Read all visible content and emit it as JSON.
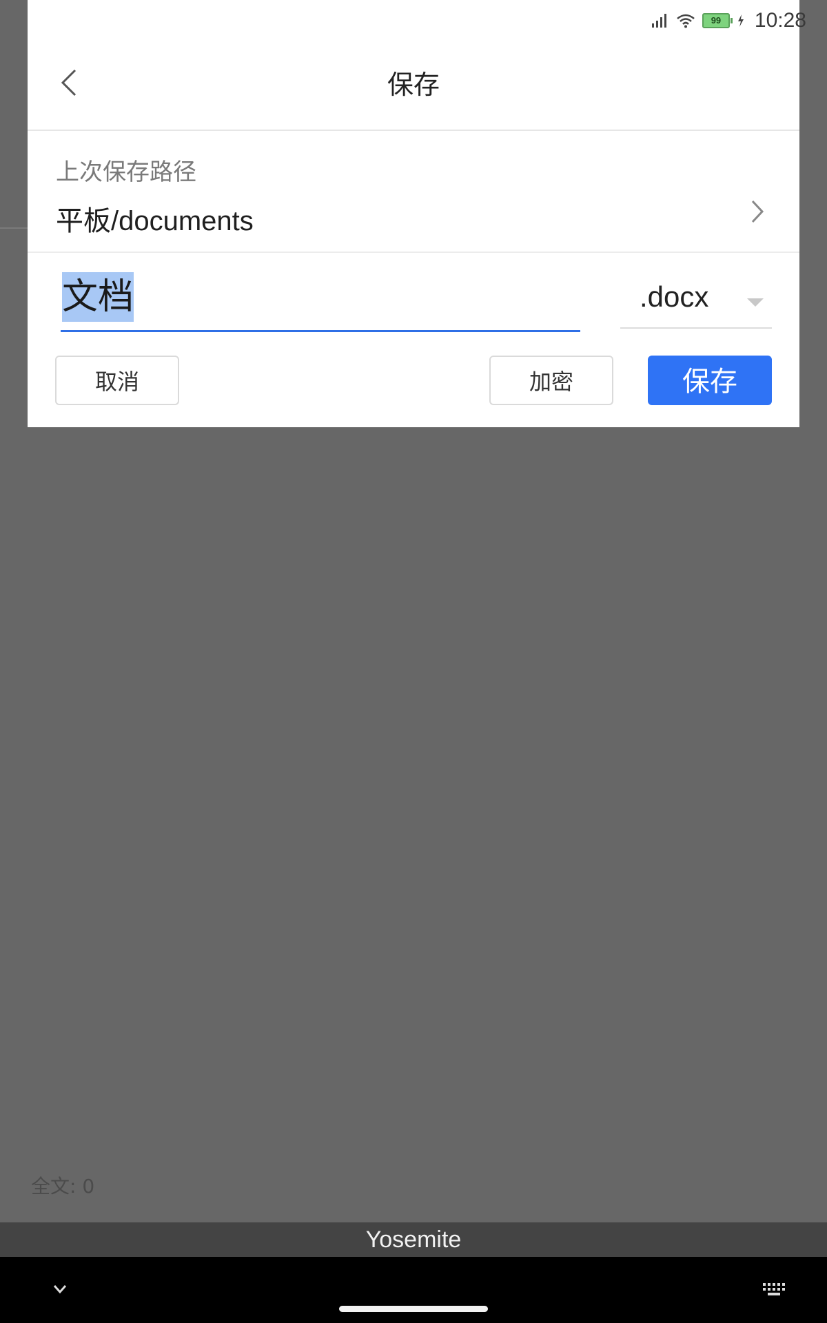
{
  "status_bar": {
    "time": "10:28",
    "battery": "99",
    "icons": [
      "signal-icon",
      "wifi-icon",
      "battery-icon",
      "charging-icon"
    ]
  },
  "dialog": {
    "title": "保存",
    "back_icon": "chevron-left-icon",
    "path_label": "上次保存路径",
    "path_value": "平板/documents",
    "filename": "文档",
    "extension": ".docx",
    "buttons": {
      "cancel": "取消",
      "encrypt": "加密",
      "save": "保存"
    },
    "colors": {
      "accent": "#2f73f5",
      "selection": "#a8c8f5"
    }
  },
  "background": {
    "word_count": "全文: 0"
  },
  "keyboard_bar": {
    "title": "Yosemite"
  }
}
